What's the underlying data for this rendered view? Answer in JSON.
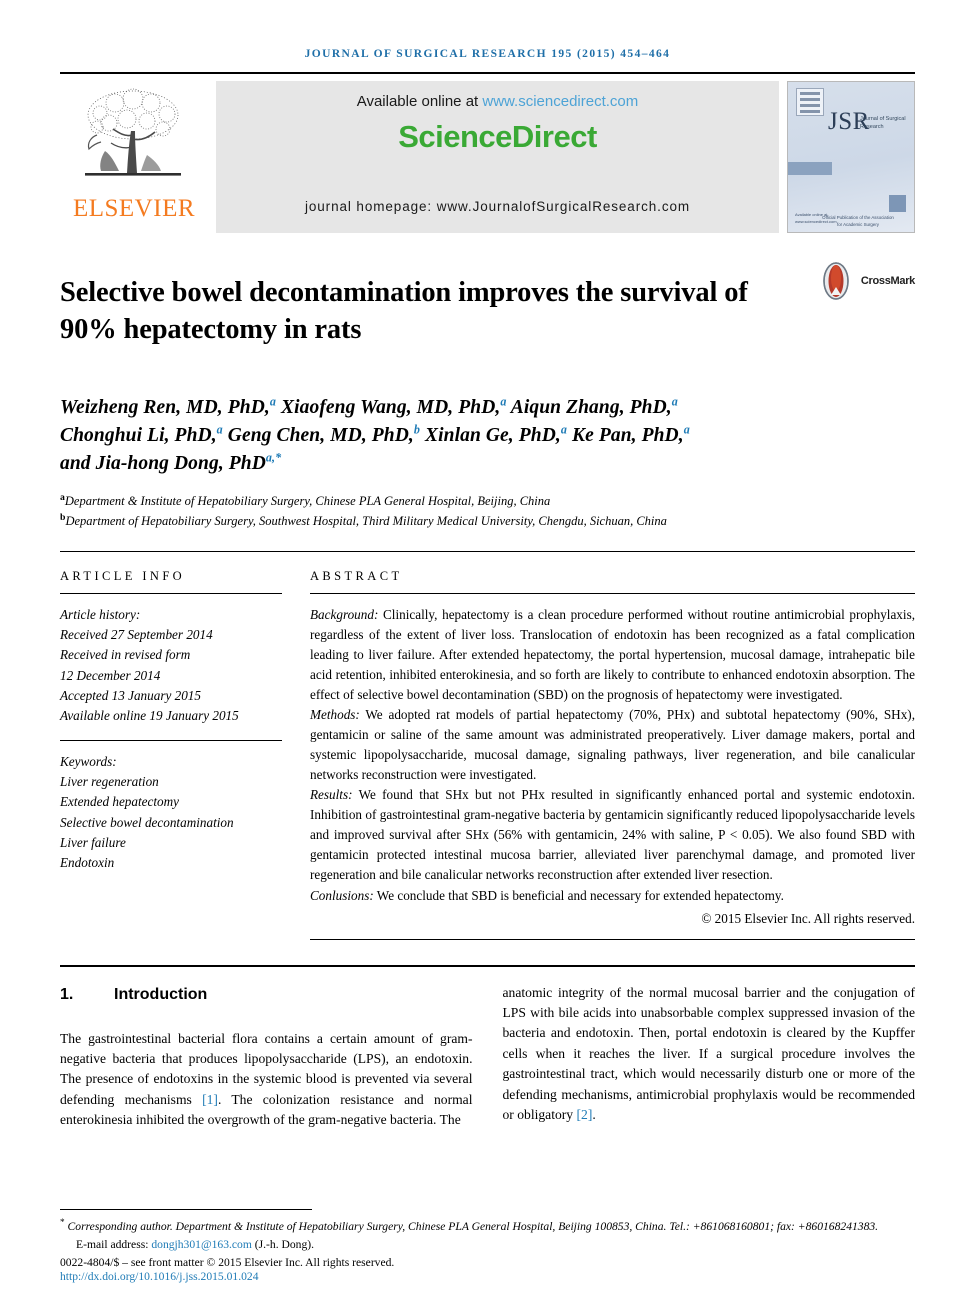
{
  "running_head": "Journal of Surgical Research 195 (2015) 454–464",
  "masthead": {
    "publisher_name": "ELSEVIER",
    "available_prefix": "Available online at ",
    "available_link": "www.sciencedirect.com",
    "wordmark": "ScienceDirect",
    "homepage": "journal homepage: www.JournalofSurgicalResearch.com",
    "cover": {
      "acronym": "JSR",
      "subtitle": "Journal of Surgical Research",
      "note": "Official Publication of the Association for Academic Surgery",
      "footer": "Available online at www.sciencedirect.com"
    }
  },
  "title": "Selective bowel decontamination improves the survival of 90% hepatectomy in rats",
  "crossmark": {
    "label": "CrossMark"
  },
  "authors": {
    "line1_a": "Weizheng Ren, MD, PhD,",
    "line1_a_sup": "a",
    "line1_b": " Xiaofeng Wang, MD, PhD,",
    "line1_b_sup": "a",
    "line1_c": " Aiqun Zhang, PhD,",
    "line1_c_sup": "a",
    "line2_a": "Chonghui Li, PhD,",
    "line2_a_sup": "a",
    "line2_b": " Geng Chen, MD, PhD,",
    "line2_b_sup": "b",
    "line2_c": " Xinlan Ge, PhD,",
    "line2_c_sup": "a",
    "line2_d": " Ke Pan, PhD,",
    "line2_d_sup": "a",
    "line3_a": "and Jia-hong Dong, PhD",
    "line3_a_sup": "a,*"
  },
  "affiliations": [
    {
      "mark": "a",
      "text": "Department & Institute of Hepatobiliary Surgery, Chinese PLA General Hospital, Beijing, China"
    },
    {
      "mark": "b",
      "text": "Department of Hepatobiliary Surgery, Southwest Hospital, Third Military Medical University, Chengdu, Sichuan, China"
    }
  ],
  "article_info": {
    "heading": "Article info",
    "history_label": "Article history:",
    "history": [
      "Received 27 September 2014",
      "Received in revised form",
      "12 December 2014",
      "Accepted 13 January 2015",
      "Available online 19 January 2015"
    ],
    "keywords_label": "Keywords:",
    "keywords": [
      "Liver regeneration",
      "Extended hepatectomy",
      "Selective bowel decontamination",
      "Liver failure",
      "Endotoxin"
    ]
  },
  "abstract": {
    "heading": "Abstract",
    "background_label": "Background:",
    "background_text": " Clinically, hepatectomy is a clean procedure performed without routine antimicrobial prophylaxis, regardless of the extent of liver loss. Translocation of endotoxin has been recognized as a fatal complication leading to liver failure. After extended hepatectomy, the portal hypertension, mucosal damage, intrahepatic bile acid retention, inhibited enterokinesia, and so forth are likely to contribute to enhanced endotoxin absorption. The effect of selective bowel decontamination (SBD) on the prognosis of hepatectomy were investigated.",
    "methods_label": "Methods:",
    "methods_text": " We adopted rat models of partial hepatectomy (70%, PHx) and subtotal hepatectomy (90%, SHx), gentamicin or saline of the same amount was administrated preoperatively. Liver damage makers, portal and systemic lipopolysaccharide, mucosal damage, signaling pathways, liver regeneration, and bile canalicular networks reconstruction were investigated.",
    "results_label": "Results:",
    "results_text": " We found that SHx but not PHx resulted in significantly enhanced portal and systemic endotoxin. Inhibition of gastrointestinal gram-negative bacteria by gentamicin significantly reduced lipopolysaccharide levels and improved survival after SHx (56% with gentamicin, 24% with saline, P < 0.05). We also found SBD with gentamicin protected intestinal mucosa barrier, alleviated liver parenchymal damage, and promoted liver regeneration and bile canalicular networks reconstruction after extended liver resection.",
    "conclusions_label": "Conlusions:",
    "conclusions_text": " We conclude that SBD is beneficial and necessary for extended hepatectomy.",
    "copyright": "© 2015 Elsevier Inc. All rights reserved."
  },
  "introduction": {
    "number": "1.",
    "title": "Introduction",
    "col1_part1": "The gastrointestinal bacterial flora contains a certain amount of gram-negative bacteria that produces lipopolysaccharide (LPS), an endotoxin. The presence of endotoxins in the systemic blood is prevented via several defending mechanisms ",
    "col1_cite1": "[1]",
    "col1_part2": ". The colonization resistance and normal enterokinesia inhibited the overgrowth of the gram-negative bacteria. The",
    "col2_part1": "anatomic integrity of the normal mucosal barrier and the conjugation of LPS with bile acids into unabsorbable complex suppressed invasion of the bacteria and endotoxin. Then, portal endotoxin is cleared by the Kupffer cells when it reaches the liver. If a surgical procedure involves the gastrointestinal tract, which would necessarily disturb one or more of the defending mechanisms, antimicrobial prophylaxis would be recommended or obligatory ",
    "col2_cite2": "[2]",
    "col2_part2": "."
  },
  "footnote": {
    "corresponding": "Corresponding author. Department & Institute of Hepatobiliary Surgery, Chinese PLA General Hospital, Beijing 100853, China. Tel.: +861068160801; fax: +860168241383.",
    "email_label": "E-mail address: ",
    "email": "dongjh301@163.com",
    "email_suffix": " (J.-h. Dong).",
    "issn_line": "0022-4804/$ – see front matter © 2015 Elsevier Inc. All rights reserved.",
    "doi": "http://dx.doi.org/10.1016/j.jss.2015.01.024"
  },
  "colors": {
    "link_blue": "#1f7bb6",
    "elsevier_orange": "#F47B20",
    "sciencedirect_green": "#3aa935",
    "banner_gray": "#e6e6e6"
  }
}
